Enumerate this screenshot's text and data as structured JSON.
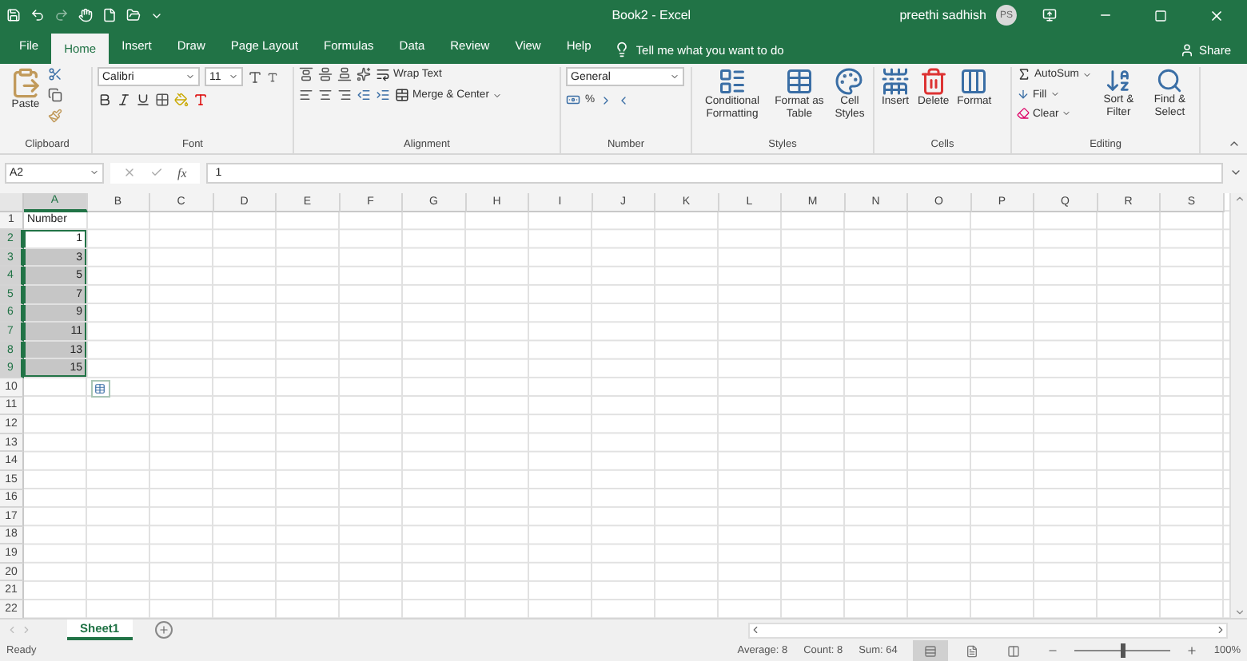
{
  "title_bar": {
    "document": "Book2 - Excel",
    "user": "preethi sadhish",
    "avatar": "PS"
  },
  "tabs": [
    {
      "label": "File",
      "selected": false
    },
    {
      "label": "Home",
      "selected": true
    },
    {
      "label": "Insert",
      "selected": false
    },
    {
      "label": "Draw",
      "selected": false
    },
    {
      "label": "Page Layout",
      "selected": false
    },
    {
      "label": "Formulas",
      "selected": false
    },
    {
      "label": "Data",
      "selected": false
    },
    {
      "label": "Review",
      "selected": false
    },
    {
      "label": "View",
      "selected": false
    },
    {
      "label": "Help",
      "selected": false
    }
  ],
  "tell_me": {
    "placeholder": "Tell me what you want to do"
  },
  "share": "Share",
  "ribbon": {
    "clipboard": {
      "label": "Clipboard",
      "paste": "Paste"
    },
    "font": {
      "label": "Font",
      "font_name": "Calibri",
      "font_size": "11"
    },
    "alignment": {
      "label": "Alignment",
      "wrap": "Wrap Text",
      "merge": "Merge & Center"
    },
    "number": {
      "label": "Number",
      "format": "General",
      "percent": "%"
    },
    "styles": {
      "label": "Styles",
      "buttons": [
        "Conditional Formatting",
        "Format as Table",
        "Cell Styles"
      ]
    },
    "cells": {
      "label": "Cells",
      "buttons": [
        "Insert",
        "Delete",
        "Format"
      ]
    },
    "editing": {
      "label": "Editing",
      "autosum": "AutoSum",
      "fill": "Fill",
      "clear": "Clear",
      "buttons": [
        "Sort & Filter",
        "Find & Select"
      ]
    }
  },
  "formula_bar": {
    "name_box": "A2",
    "fx": "fx",
    "value": "1"
  },
  "columns": [
    {
      "label": "A",
      "selected": true
    },
    {
      "label": "B",
      "selected": false
    },
    {
      "label": "C",
      "selected": false
    },
    {
      "label": "D",
      "selected": false
    },
    {
      "label": "E",
      "selected": false
    },
    {
      "label": "F",
      "selected": false
    },
    {
      "label": "G",
      "selected": false
    },
    {
      "label": "H",
      "selected": false
    },
    {
      "label": "I",
      "selected": false
    },
    {
      "label": "J",
      "selected": false
    },
    {
      "label": "K",
      "selected": false
    },
    {
      "label": "L",
      "selected": false
    },
    {
      "label": "M",
      "selected": false
    },
    {
      "label": "N",
      "selected": false
    },
    {
      "label": "O",
      "selected": false
    },
    {
      "label": "P",
      "selected": false
    },
    {
      "label": "Q",
      "selected": false
    },
    {
      "label": "R",
      "selected": false
    },
    {
      "label": "S",
      "selected": false
    }
  ],
  "rows": [
    {
      "header": "1",
      "cell": "Number",
      "selected": false
    },
    {
      "header": "2",
      "cell": "1",
      "selected": true
    },
    {
      "header": "3",
      "cell": "3",
      "selected": true
    },
    {
      "header": "4",
      "cell": "5",
      "selected": true
    },
    {
      "header": "5",
      "cell": "7",
      "selected": true
    },
    {
      "header": "6",
      "cell": "9",
      "selected": true
    },
    {
      "header": "7",
      "cell": "11",
      "selected": true
    },
    {
      "header": "8",
      "cell": "13",
      "selected": true
    },
    {
      "header": "9",
      "cell": "15",
      "selected": true
    },
    {
      "header": "10",
      "selected": false
    },
    {
      "header": "11",
      "selected": false
    },
    {
      "header": "12",
      "selected": false
    },
    {
      "header": "13",
      "selected": false
    },
    {
      "header": "14",
      "selected": false
    },
    {
      "header": "15",
      "selected": false
    },
    {
      "header": "16",
      "selected": false
    },
    {
      "header": "17",
      "selected": false
    },
    {
      "header": "18",
      "selected": false
    },
    {
      "header": "19",
      "selected": false
    },
    {
      "header": "20",
      "selected": false
    },
    {
      "header": "21",
      "selected": false
    },
    {
      "header": "22",
      "selected": false
    }
  ],
  "sheets": [
    {
      "label": "Sheet1",
      "selected": true
    }
  ],
  "status_bar": {
    "state": "Ready",
    "stats": [
      "Average: 8",
      "Count: 8",
      "Sum: 64"
    ],
    "views": [
      {
        "kind": "normal",
        "selected": true
      },
      {
        "kind": "page_layout",
        "selected": false
      },
      {
        "kind": "page_break",
        "selected": false
      }
    ],
    "zoom": {
      "level": 0.5,
      "reading": "100%"
    }
  }
}
